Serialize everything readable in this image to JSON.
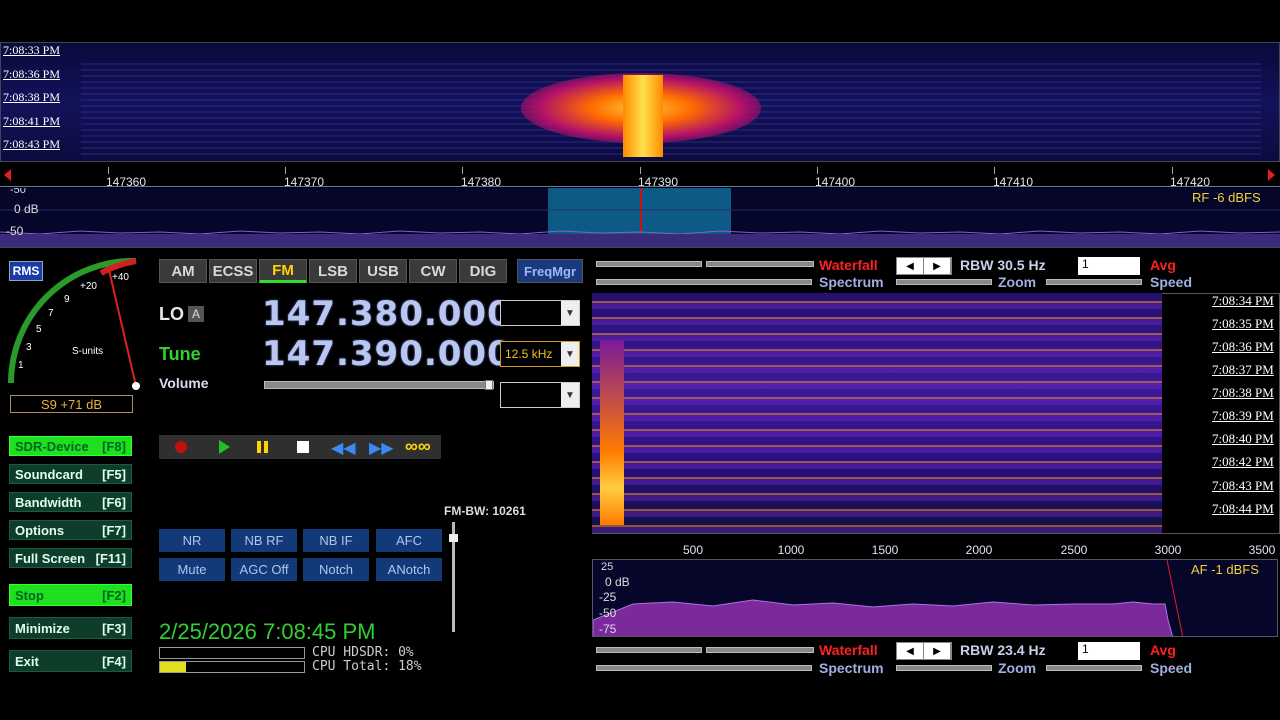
{
  "top_waterfall": {
    "times": [
      "7:08:33 PM",
      "7:08:36 PM",
      "7:08:38 PM",
      "7:08:41 PM",
      "7:08:43 PM"
    ]
  },
  "freq_scale": [
    "147360",
    "147370",
    "147380",
    "147390",
    "147400",
    "147410",
    "147420"
  ],
  "rf_panel": {
    "db_top": "-50",
    "db_zero": "0 dB",
    "db_bottom": "-50",
    "rf_level": "RF  -6 dBFS"
  },
  "smeter": {
    "mode_button": "RMS",
    "scale": [
      "1",
      "3",
      "5",
      "7",
      "9",
      "+20",
      "+40"
    ],
    "units_label": "S-units",
    "reading": "S9 +71 dB"
  },
  "side_buttons": [
    {
      "label": "SDR-Device",
      "key": "[F8]",
      "active": true
    },
    {
      "label": "Soundcard",
      "key": "[F5]",
      "active": false
    },
    {
      "label": "Bandwidth",
      "key": "[F6]",
      "active": false
    },
    {
      "label": "Options",
      "key": "[F7]",
      "active": false
    },
    {
      "label": "Full Screen",
      "key": "[F11]",
      "active": false
    },
    {
      "label": "Stop",
      "key": "[F2]",
      "active": true
    },
    {
      "label": "Minimize",
      "key": "[F3]",
      "active": false
    },
    {
      "label": "Exit",
      "key": "[F4]",
      "active": false
    }
  ],
  "modes": [
    "AM",
    "ECSS",
    "FM",
    "LSB",
    "USB",
    "CW",
    "DIG"
  ],
  "active_mode": "FM",
  "freqmgr": "FreqMgr",
  "lo": {
    "label": "LO",
    "badge": "A",
    "value": "147.380.000"
  },
  "tune": {
    "label": "Tune",
    "value": "147.390.000",
    "step": "12.5 kHz"
  },
  "volume_label": "Volume",
  "fm_bw": "FM-BW: 10261",
  "dsp_buttons": [
    [
      "NR",
      "NB RF",
      "NB IF",
      "AFC"
    ],
    [
      "Mute",
      "AGC Off",
      "Notch",
      "ANotch"
    ]
  ],
  "datetime": "2/25/2026 7:08:45 PM",
  "cpu": {
    "hdsdr": "CPU HDSDR: 0%",
    "total": "CPU Total: 18%"
  },
  "top_controls": {
    "waterfall": "Waterfall",
    "spectrum": "Spectrum",
    "rbw": "RBW 30.5 Hz",
    "zoom": "Zoom",
    "avg_value": "1",
    "avg": "Avg",
    "speed": "Speed"
  },
  "af_waterfall_times": [
    "7:08:34 PM",
    "7:08:35 PM",
    "7:08:36 PM",
    "7:08:37 PM",
    "7:08:38 PM",
    "7:08:39 PM",
    "7:08:40 PM",
    "7:08:42 PM",
    "7:08:43 PM",
    "7:08:44 PM"
  ],
  "af_scale": [
    "500",
    "1000",
    "1500",
    "2000",
    "2500",
    "3000",
    "3500"
  ],
  "af_spec": {
    "db": [
      "25",
      "0 dB",
      "-25",
      "-50",
      "-75"
    ],
    "level": "AF  -1 dBFS"
  },
  "bottom_controls": {
    "waterfall": "Waterfall",
    "spectrum": "Spectrum",
    "rbw": "RBW 23.4 Hz",
    "zoom": "Zoom",
    "avg_value": "1",
    "avg": "Avg",
    "speed": "Speed"
  },
  "colors": {
    "accent_green": "#1fe01f",
    "freq_blue": "#b8c6f0",
    "red": "#ff2020",
    "yellow": "#ffd400"
  }
}
